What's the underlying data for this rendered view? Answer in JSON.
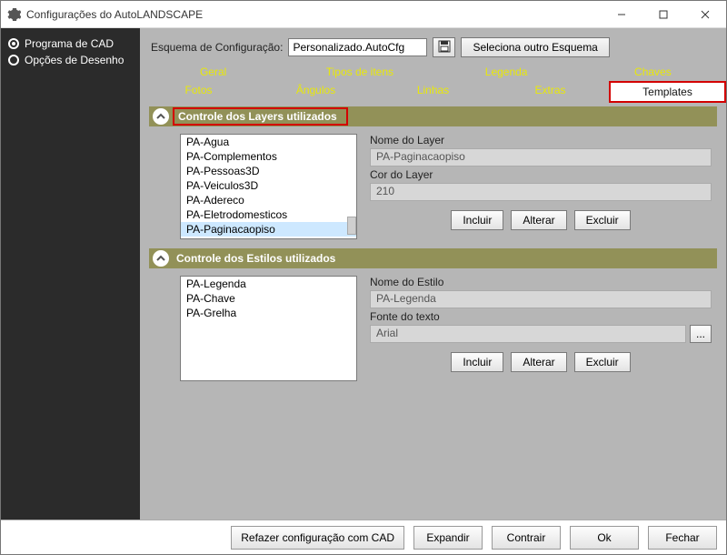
{
  "window": {
    "title": "Configurações do AutoLANDSCAPE"
  },
  "sidebar": {
    "items": [
      {
        "label": "Programa de CAD",
        "checked": true
      },
      {
        "label": "Opções de Desenho",
        "checked": false
      }
    ]
  },
  "scheme": {
    "label": "Esquema de Configuração:",
    "value": "Personalizado.AutoCfg",
    "select_other": "Seleciona outro Esquema"
  },
  "tabs_row1": [
    "Geral",
    "Tipos de itens",
    "Legenda",
    "Chaves"
  ],
  "tabs_row2": [
    "Fotos",
    "Ângulos",
    "Linhas",
    "Extras",
    "Templates"
  ],
  "layers_panel": {
    "title": "Controle dos Layers utilizados",
    "items": [
      "PA-Agua",
      "PA-Complementos",
      "PA-Pessoas3D",
      "PA-Veiculos3D",
      "PA-Adereco",
      "PA-Eletrodomesticos",
      "PA-Paginacaopiso"
    ],
    "selected": "PA-Paginacaopiso",
    "name_label": "Nome do Layer",
    "name_value": "PA-Paginacaopiso",
    "color_label": "Cor do Layer",
    "color_value": "210",
    "buttons": {
      "include": "Incluir",
      "alter": "Alterar",
      "exclude": "Excluir"
    }
  },
  "styles_panel": {
    "title": "Controle dos Estilos utilizados",
    "items": [
      "PA-Legenda",
      "PA-Chave",
      "PA-Grelha"
    ],
    "name_label": "Nome do Estilo",
    "name_value": "PA-Legenda",
    "font_label": "Fonte do texto",
    "font_value": "Arial",
    "buttons": {
      "include": "Incluir",
      "alter": "Alterar",
      "exclude": "Excluir"
    }
  },
  "footer": {
    "redo": "Refazer configuração com CAD",
    "expand": "Expandir",
    "contract": "Contrair",
    "ok": "Ok",
    "close": "Fechar"
  }
}
